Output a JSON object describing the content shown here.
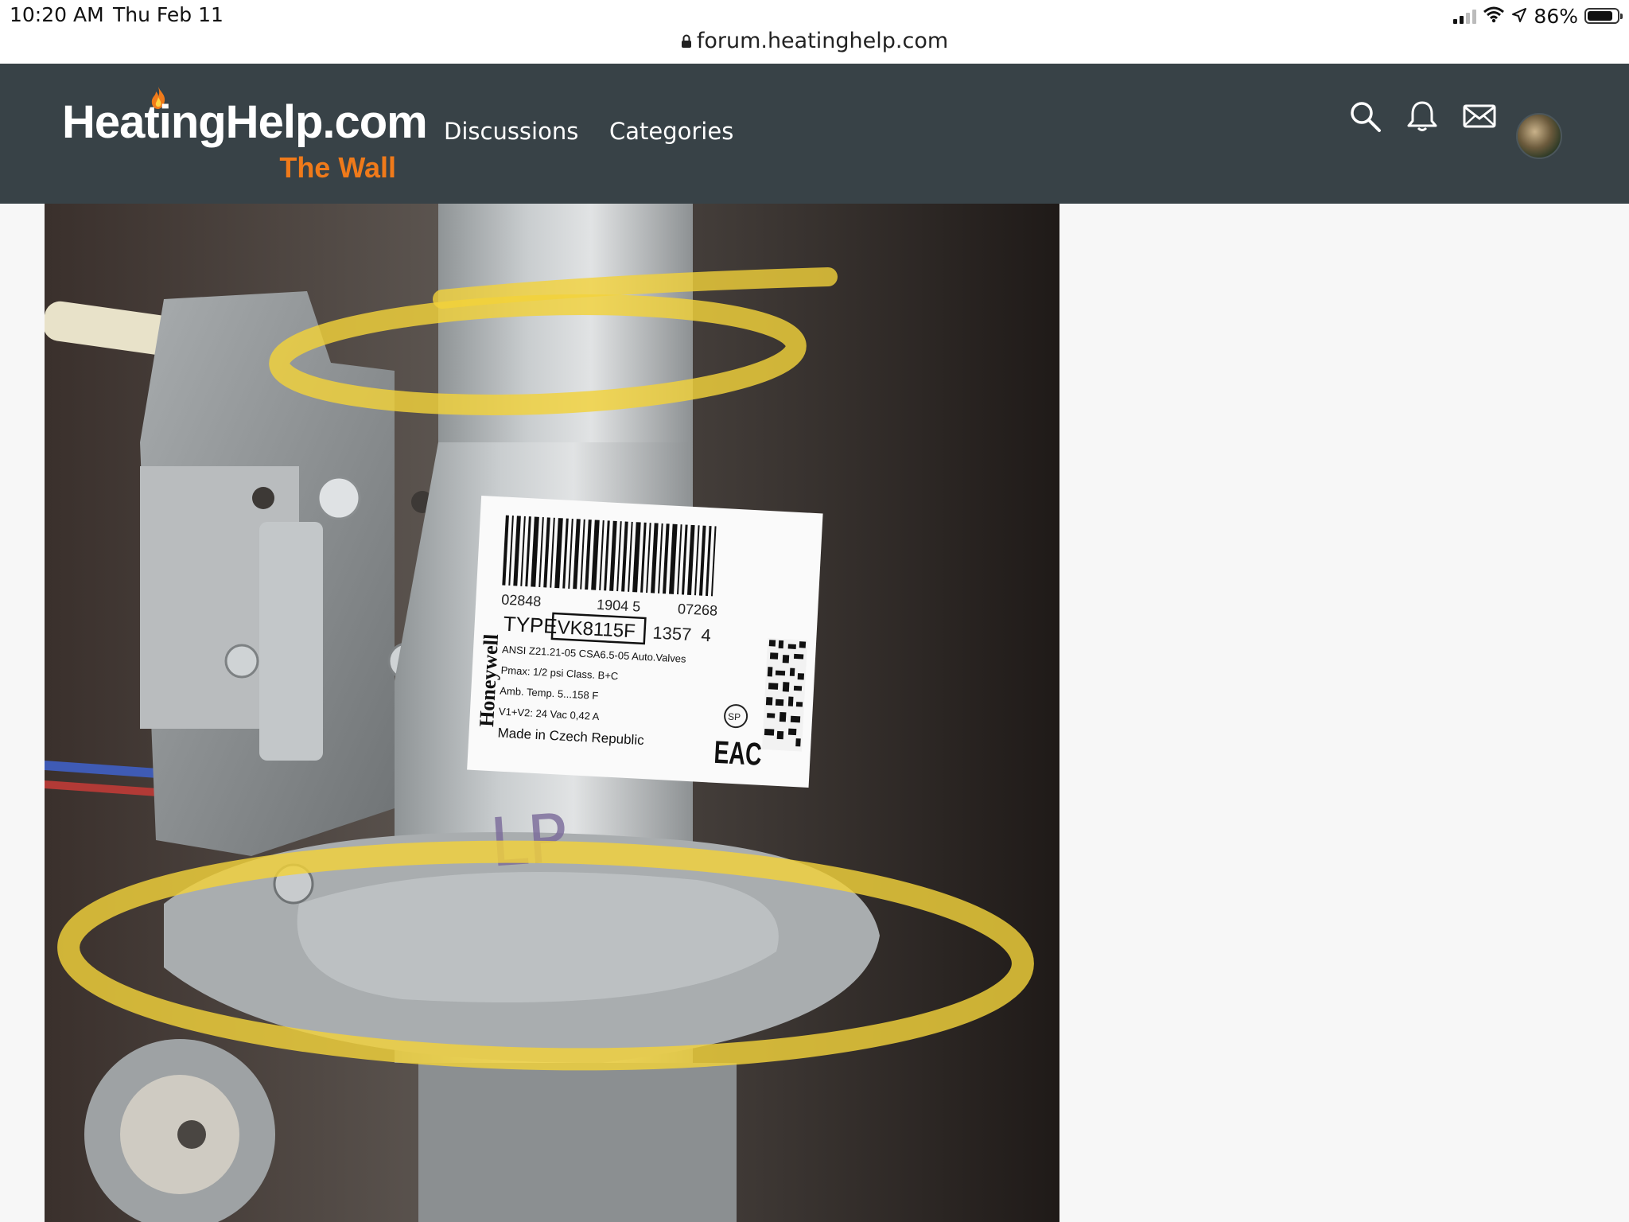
{
  "status_bar": {
    "time": "10:20 AM",
    "date": "Thu Feb 11",
    "url": "forum.heatinghelp.com",
    "battery_percent": "86%",
    "battery_level": 0.86,
    "icons": [
      "signal-icon",
      "wifi-icon",
      "location-arrow-icon",
      "battery-icon",
      "lock-icon"
    ]
  },
  "header": {
    "logo_main": "HeatingHelp.com",
    "logo_sub": "The Wall",
    "nav": [
      {
        "label": "Discussions"
      },
      {
        "label": "Categories"
      }
    ],
    "icons": [
      "search-icon",
      "bell-icon",
      "mail-icon",
      "avatar"
    ],
    "colors": {
      "background": "#384247",
      "accent": "#f07a1a",
      "text": "#ffffff"
    }
  },
  "photo": {
    "highlight_color": "#f2d23a",
    "label": {
      "brand": "Honeywell",
      "barcode_left": "02848",
      "barcode_mid": "1904 5",
      "barcode_right": "07268",
      "type_prefix": "TYPE",
      "type_value": "VK8115F",
      "type_suffix": "1357  4",
      "line1": "ANSI Z21.21-05 CSA6.5-05 Auto.Valves",
      "line2": "Pmax: 1/2 psi Class. B+C",
      "line3": "Amb. Temp. 5...158 F",
      "line4": "V1+V2: 24 Vac 0,42 A",
      "line5": "Made in Czech Republic",
      "cert_mark": "EAC",
      "csa_mark": "SP"
    },
    "handwriting": "LP"
  }
}
